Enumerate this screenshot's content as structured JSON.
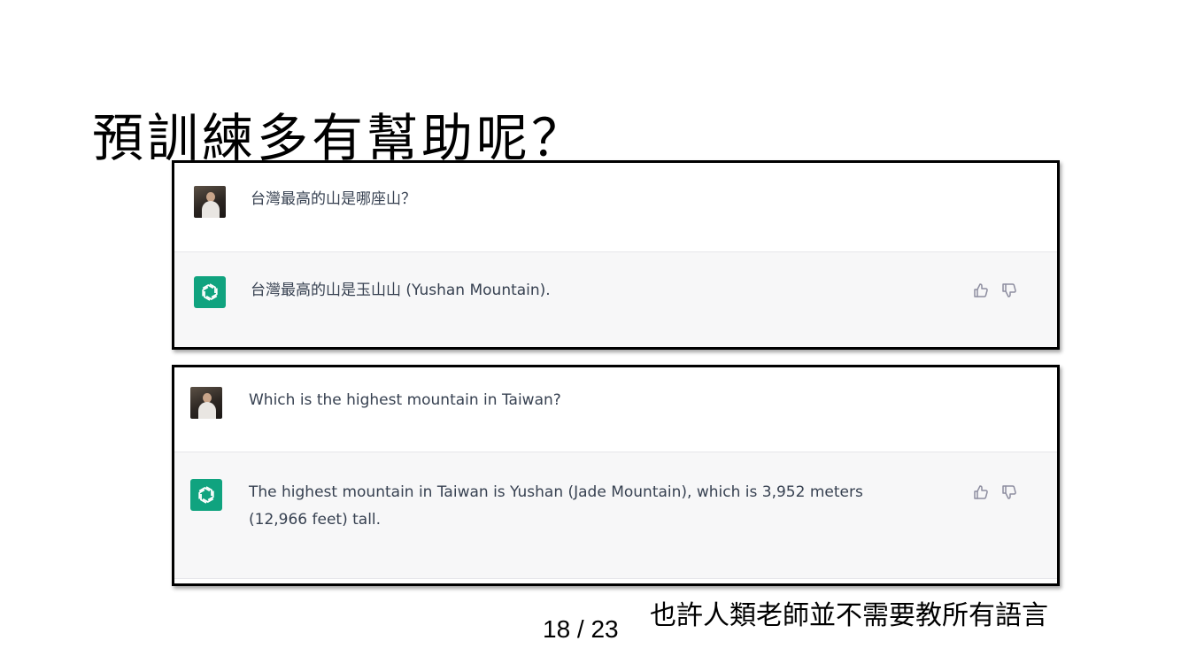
{
  "slide": {
    "title": "預訓練多有幫助呢？",
    "page_number": "18 / 23",
    "caption": "也許人類老師並不需要教所有語言"
  },
  "chat_zh": {
    "user_message": "台灣最高的山是哪座山？",
    "assistant_message": "台灣最高的山是玉山山 (Yushan Mountain)."
  },
  "chat_en": {
    "user_message": "Which is the highest mountain in Taiwan?",
    "assistant_message": "The highest mountain in Taiwan is Yushan (Jade Mountain), which is 3,952 meters (12,966 feet) tall."
  },
  "icons": {
    "user_avatar": "user-avatar-photo",
    "assistant_avatar": "openai-logo-icon",
    "like": "thumbs-up-icon",
    "dislike": "thumbs-down-icon"
  },
  "colors": {
    "assistant_logo_bg": "#10a37f",
    "assistant_row_bg": "#f7f7f8",
    "message_text": "#374151"
  }
}
